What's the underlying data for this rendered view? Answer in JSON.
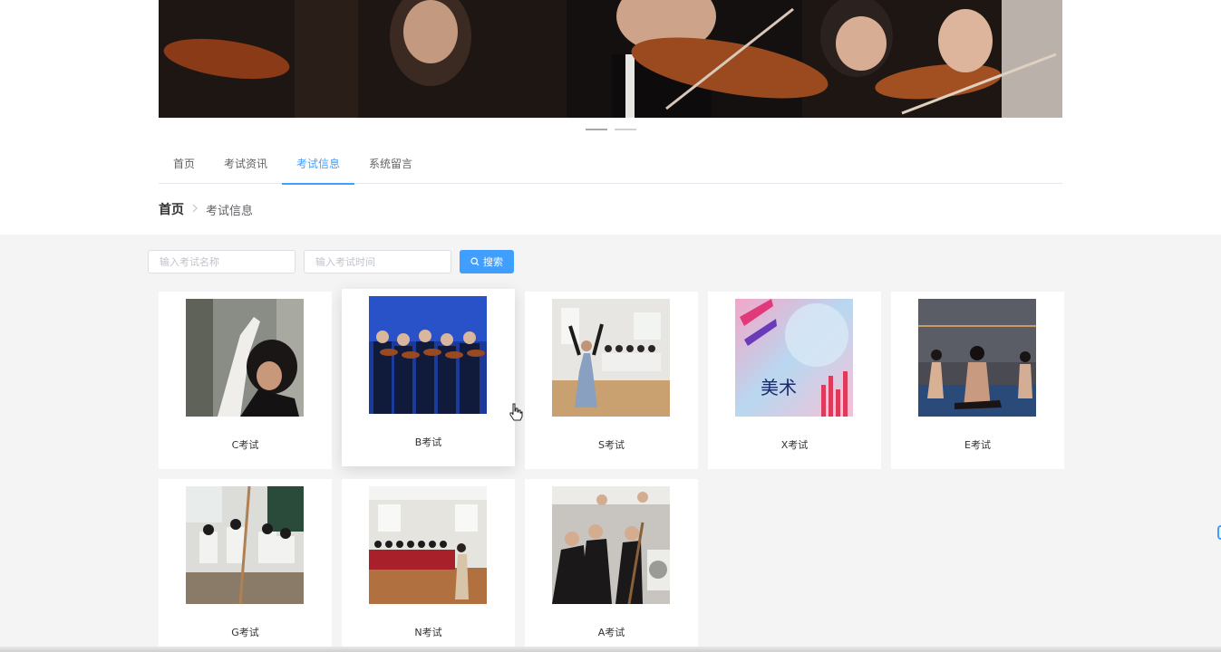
{
  "nav": {
    "tabs": [
      {
        "label": "首页",
        "active": false
      },
      {
        "label": "考试资讯",
        "active": false
      },
      {
        "label": "考试信息",
        "active": true
      },
      {
        "label": "系统留言",
        "active": false
      }
    ]
  },
  "breadcrumb": {
    "home": "首页",
    "separator": ">",
    "current": "考试信息"
  },
  "search": {
    "name_placeholder": "输入考试名称",
    "time_placeholder": "输入考试时间",
    "button_label": "搜索"
  },
  "colors": {
    "accent": "#409eff",
    "page_bg": "#f4f4f4",
    "card_bg": "#ffffff"
  },
  "cards": [
    {
      "title": "C考试",
      "image": "dance-stretch-photo"
    },
    {
      "title": "B考试",
      "image": "violin-ensemble-photo"
    },
    {
      "title": "S考试",
      "image": "dance-audition-photo"
    },
    {
      "title": "X考试",
      "image": "art-poster-image"
    },
    {
      "title": "E考试",
      "image": "ballet-class-photo"
    },
    {
      "title": "G考试",
      "image": "sketch-class-photo"
    },
    {
      "title": "N考试",
      "image": "exam-hall-photo"
    },
    {
      "title": "A考试",
      "image": "drawing-students-photo"
    }
  ]
}
